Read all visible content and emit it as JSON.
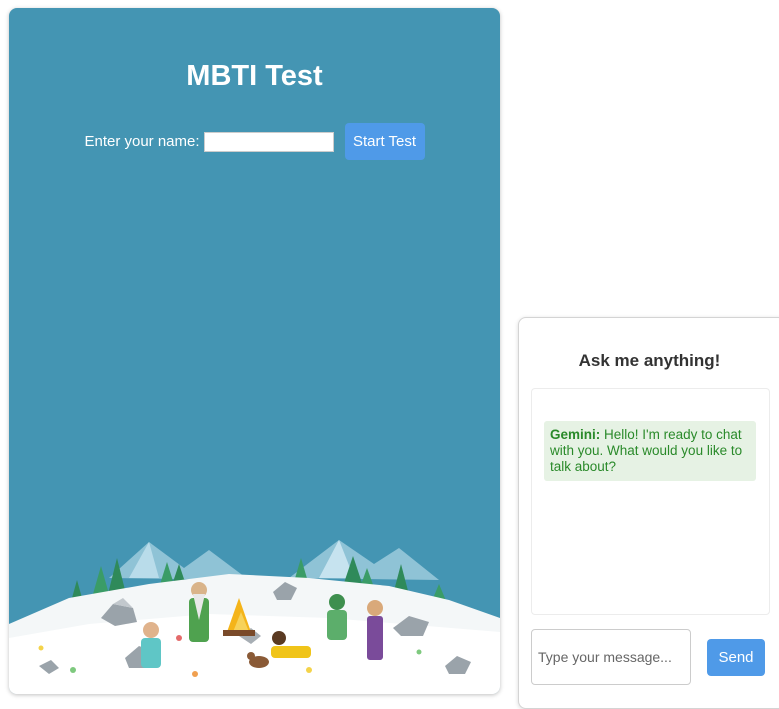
{
  "test": {
    "title": "MBTI Test",
    "name_label": "Enter your name:",
    "name_value": "",
    "start_label": "Start Test",
    "background_color": "#4495b3",
    "illustration": "snowy-campfire-scene"
  },
  "chat": {
    "title": "Ask me anything!",
    "messages": [
      {
        "sender": "Gemini:",
        "text": " Hello! I'm ready to chat with you. What would you like to talk about?"
      }
    ],
    "input_placeholder": "Type your message...",
    "send_label": "Send",
    "accent_color": "#4f9ae8",
    "message_bg": "#e6f2e4",
    "message_text_color": "#2a8a2a"
  }
}
